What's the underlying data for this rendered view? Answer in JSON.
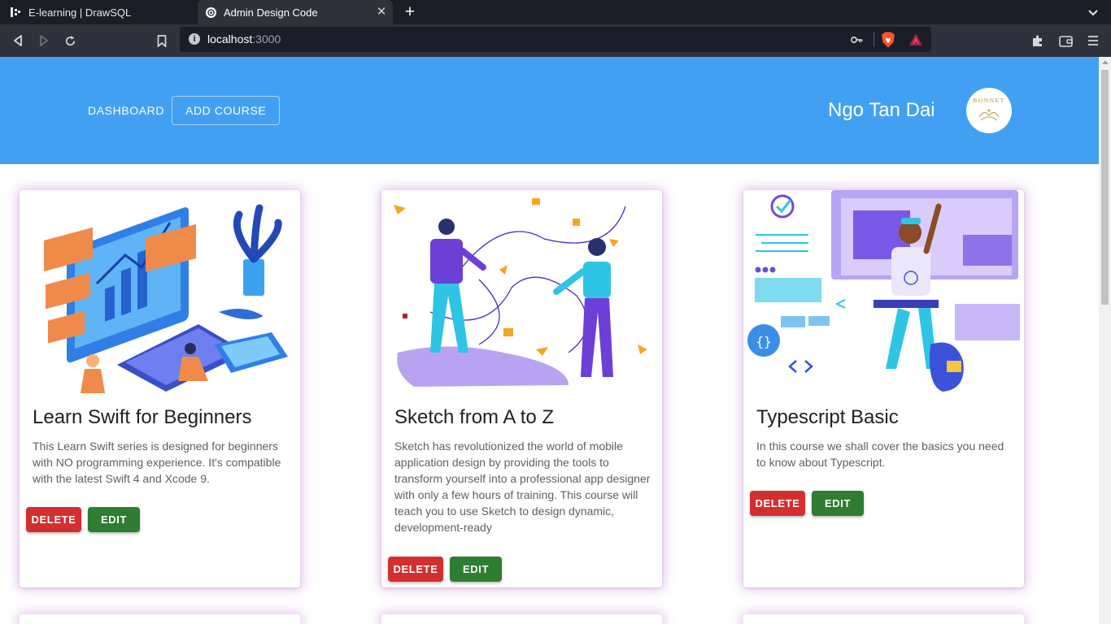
{
  "browser": {
    "tabs": [
      {
        "title": "E-learning | DrawSQL",
        "active": false
      },
      {
        "title": "Admin Design Code",
        "active": true
      }
    ],
    "url_host": "localhost",
    "url_port": ":3000",
    "info_glyph": "i",
    "close_glyph": "✕",
    "new_tab_glyph": "+"
  },
  "appbar": {
    "nav_dashboard": "DASHBOARD",
    "nav_add_course": "ADD COURSE",
    "user_name": "Ngo Tan Dai",
    "avatar_text": "BONNET"
  },
  "courses": [
    {
      "title": "Learn Swift for Beginners",
      "description": "This Learn Swift series is designed for beginners with NO programming experience. It's compatible with the latest Swift 4 and Xcode 9.",
      "delete_label": "DELETE",
      "edit_label": "EDIT"
    },
    {
      "title": "Sketch from A to Z",
      "description": "Sketch has revolutionized the world of mobile application design by providing the tools to transform yourself into a professional app designer with only a few hours of training. This course will teach you to use Sketch to design dynamic, development-ready",
      "delete_label": "DELETE",
      "edit_label": "EDIT"
    },
    {
      "title": "Typescript Basic",
      "description": "In this course we shall cover the basics you need to know about Typescript.",
      "delete_label": "DELETE",
      "edit_label": "EDIT"
    }
  ],
  "colors": {
    "appbar": "#42a0f2",
    "delete": "#d32f2f",
    "edit": "#2e7d32",
    "card_glow": "#ba5cce"
  },
  "icons": [
    "drawsql-icon",
    "site-icon",
    "back-icon",
    "forward-icon",
    "reload-icon",
    "bookmark-icon",
    "info-icon",
    "key-icon",
    "brave-shield-icon",
    "bat-icon",
    "extensions-icon",
    "wallet-icon",
    "menu-icon",
    "chevron-down-icon"
  ]
}
